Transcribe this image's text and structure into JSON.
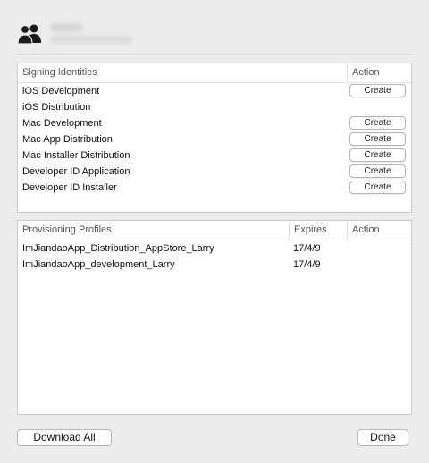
{
  "identities": {
    "col_name": "Signing Identities",
    "col_action": "Action",
    "rows": [
      {
        "name": "iOS Development",
        "action": "Create"
      },
      {
        "name": "iOS Distribution",
        "action": ""
      },
      {
        "name": "Mac Development",
        "action": "Create"
      },
      {
        "name": "Mac App Distribution",
        "action": "Create"
      },
      {
        "name": "Mac Installer Distribution",
        "action": "Create"
      },
      {
        "name": "Developer ID Application",
        "action": "Create"
      },
      {
        "name": "Developer ID Installer",
        "action": "Create"
      }
    ]
  },
  "profiles": {
    "col_name": "Provisioning Profiles",
    "col_expires": "Expires",
    "col_action": "Action",
    "rows": [
      {
        "name": "ImJiandaoApp_Distribution_AppStore_Larry",
        "expires": "17/4/9"
      },
      {
        "name": "ImJiandaoApp_development_Larry",
        "expires": "17/4/9"
      }
    ]
  },
  "footer": {
    "download_label": "Download All",
    "done_label": "Done"
  }
}
